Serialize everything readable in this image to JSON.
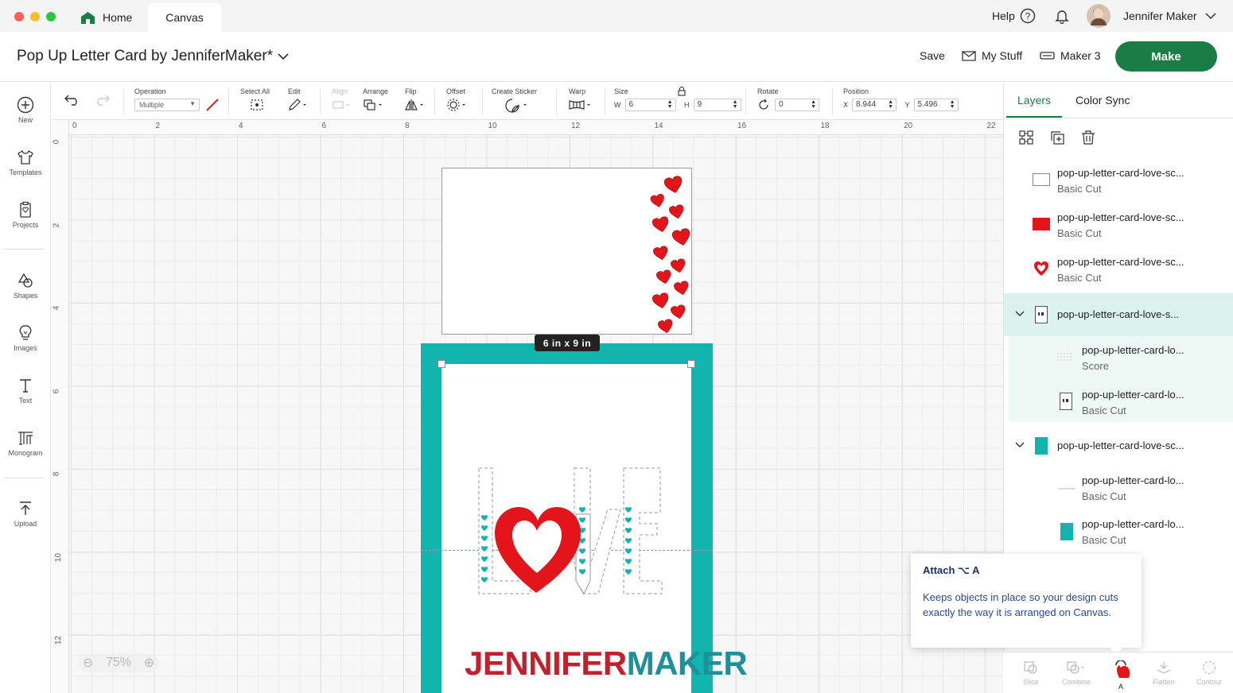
{
  "tabbar": {
    "home_label": "Home",
    "canvas_label": "Canvas",
    "help_label": "Help",
    "user_name": "Jennifer Maker"
  },
  "header": {
    "title": "Pop Up Letter Card by JenniferMaker*",
    "save_label": "Save",
    "mystuff_label": "My Stuff",
    "machine_label": "Maker 3",
    "make_label": "Make"
  },
  "sidebar": {
    "items": [
      {
        "label": "New",
        "icon": "plus-circle-icon"
      },
      {
        "label": "Templates",
        "icon": "tshirt-icon"
      },
      {
        "label": "Projects",
        "icon": "clipboard-icon"
      },
      {
        "label": "Shapes",
        "icon": "shapes-icon"
      },
      {
        "label": "Images",
        "icon": "lightbulb-icon"
      },
      {
        "label": "Text",
        "icon": "text-icon"
      },
      {
        "label": "Monogram",
        "icon": "monogram-icon"
      },
      {
        "label": "Upload",
        "icon": "upload-icon"
      }
    ]
  },
  "toolbar": {
    "operation_label": "Operation",
    "operation_value": "Multiple",
    "select_all_label": "Select All",
    "edit_label": "Edit",
    "align_label": "Align",
    "arrange_label": "Arrange",
    "flip_label": "Flip",
    "offset_label": "Offset",
    "create_sticker_label": "Create Sticker",
    "warp_label": "Warp",
    "size_label": "Size",
    "w_label": "W",
    "w_value": "6",
    "h_label": "H",
    "h_value": "9",
    "rotate_label": "Rotate",
    "rotate_value": "0",
    "position_label": "Position",
    "x_label": "X",
    "x_value": "8.944",
    "y_label": "Y",
    "y_value": "5.496"
  },
  "canvas": {
    "ruler_top": [
      "0",
      "2",
      "4",
      "6",
      "8",
      "10",
      "12",
      "14",
      "16",
      "18",
      "20",
      "22"
    ],
    "ruler_left": [
      "0",
      "2",
      "4",
      "6",
      "8",
      "10",
      "12"
    ],
    "size_badge": "6 in x 9 in",
    "zoom_value": "75%",
    "watermark_a": "JENNIFER",
    "watermark_b": "MAKER",
    "colors": {
      "teal": "#12b5ae",
      "heart_red": "#e3151b"
    }
  },
  "panel": {
    "tab_layers": "Layers",
    "tab_colorsync": "Color Sync",
    "layers": [
      {
        "name": "pop-up-letter-card-love-sc...",
        "type": "Basic Cut"
      },
      {
        "name": "pop-up-letter-card-love-sc...",
        "type": "Basic Cut"
      },
      {
        "name": "pop-up-letter-card-love-sc...",
        "type": "Basic Cut"
      },
      {
        "name": "pop-up-letter-card-love-s...",
        "type": ""
      },
      {
        "name": "pop-up-letter-card-lo...",
        "type": "Score"
      },
      {
        "name": "pop-up-letter-card-lo...",
        "type": "Basic Cut"
      },
      {
        "name": "pop-up-letter-card-love-sc...",
        "type": ""
      },
      {
        "name": "pop-up-letter-card-lo...",
        "type": "Basic Cut"
      },
      {
        "name": "pop-up-letter-card-lo...",
        "type": "Basic Cut"
      }
    ]
  },
  "tooltip": {
    "title": "Attach ⌥ A",
    "body": "Keeps objects in place so your design cuts exactly the way it is arranged on Canvas."
  },
  "bottom_bar": {
    "slice": "Slice",
    "combine": "Combine",
    "attach": "A",
    "flatten": "Flatten",
    "contour": "Contour"
  }
}
